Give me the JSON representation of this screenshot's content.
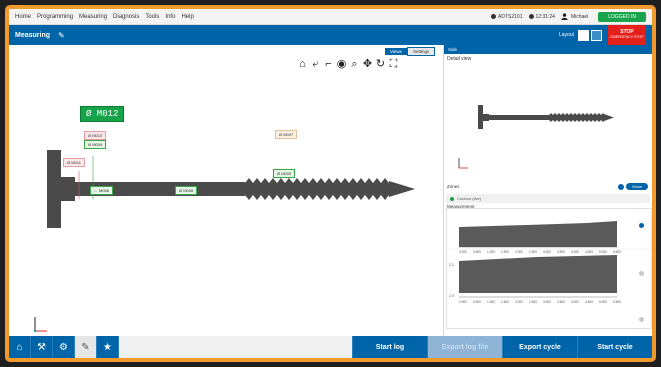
{
  "menubar": {
    "items": [
      "Home",
      "Programming",
      "Measuring",
      "Diagnosis",
      "Tools",
      "Info",
      "Help"
    ],
    "status_a": "ADTS2101",
    "status_b": "12:31:24",
    "user": "Michael",
    "green_button": "LOGGED IN"
  },
  "titlebar": {
    "title": "Measuring",
    "layout_label": "Layout",
    "stop_label": "STOP",
    "stop_sub": "EMERGENCY STOP"
  },
  "view_tabs": [
    "Views",
    "Settings",
    "Side"
  ],
  "right_panel": {
    "header": "Side",
    "zoom_title": "Detail view",
    "zones_label": "Zones",
    "toggle_label": "Show",
    "radio_label": "Contour (live)",
    "measured_label": "Measurement",
    "chart_x_ticks_1": [
      "0.000",
      "0.500",
      "1.000",
      "1.500",
      "2.000",
      "2.500",
      "3.000",
      "3.500",
      "4.000",
      "4.500",
      "5.000",
      "5.500"
    ],
    "chart_x_ticks_2": [
      "0.000",
      "0.500",
      "1.000",
      "1.500",
      "2.000",
      "2.500",
      "3.000",
      "3.500",
      "4.000",
      "4.500",
      "5.000",
      "5.500"
    ],
    "y_label_top": "2.2",
    "y_label_bottom": "2.0"
  },
  "tags": {
    "main": "Ø M012",
    "t1": "Ø M010",
    "t2": "Ø M009",
    "t3": "Ø M011",
    "t4": "Ø M007",
    "t5": "∟ M006",
    "t6": "Ø M008",
    "t7": "Ø M005"
  },
  "bottom": {
    "start_log": "Start log",
    "export_log": "Export log file",
    "export_cycle": "Export cycle",
    "start_cycle": "Start cycle"
  },
  "colors": {
    "brand_blue": "#0064a8",
    "accent_green": "#16a34a",
    "stop_red": "#e3201b",
    "frame_orange": "#f29a2e"
  }
}
